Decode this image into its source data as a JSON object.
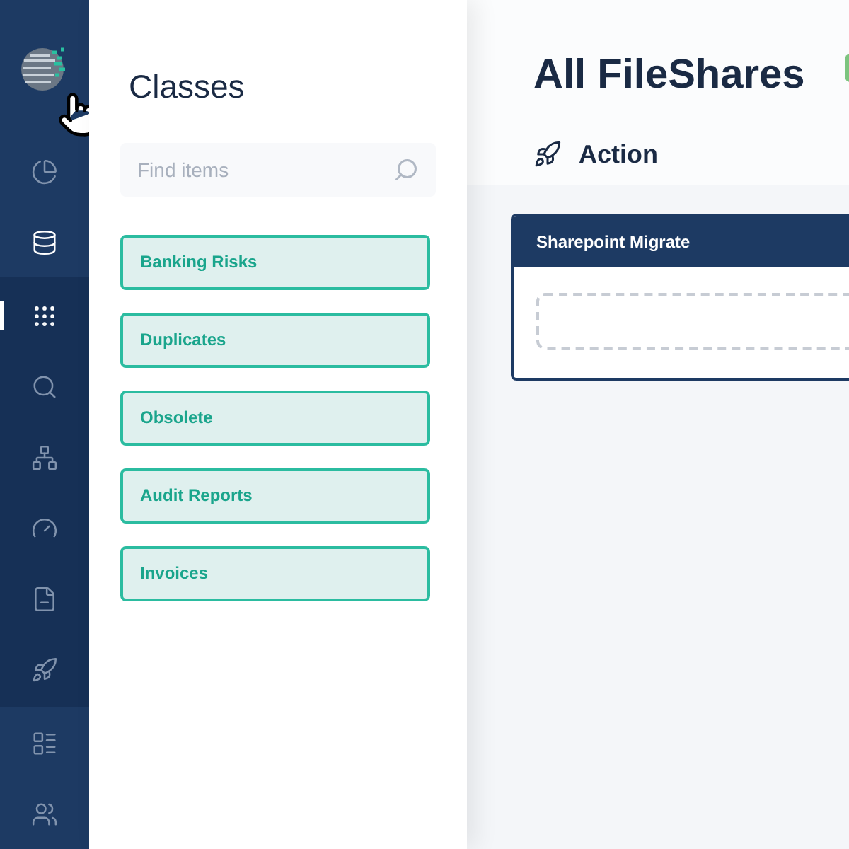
{
  "sidebar": {
    "top_items": [
      {
        "kind": "chart",
        "selected": false
      },
      {
        "kind": "database",
        "selected": true
      }
    ],
    "group_items": [
      {
        "kind": "grid",
        "selected": true
      },
      {
        "kind": "search",
        "selected": false
      },
      {
        "kind": "hierarchy",
        "selected": false
      },
      {
        "kind": "gauge",
        "selected": false
      },
      {
        "kind": "document",
        "selected": false
      },
      {
        "kind": "rocket",
        "selected": false
      }
    ],
    "bottom_items": [
      {
        "kind": "list",
        "selected": false
      },
      {
        "kind": "users",
        "selected": false
      }
    ]
  },
  "classes_panel": {
    "title": "Classes",
    "search": {
      "placeholder": "Find items"
    },
    "items": [
      "Banking Risks",
      "Duplicates",
      "Obsolete",
      "Audit Reports",
      "Invoices"
    ]
  },
  "main": {
    "title": "All FileShares",
    "section": "Action",
    "card": {
      "title": "Sharepoint Migrate"
    }
  }
}
